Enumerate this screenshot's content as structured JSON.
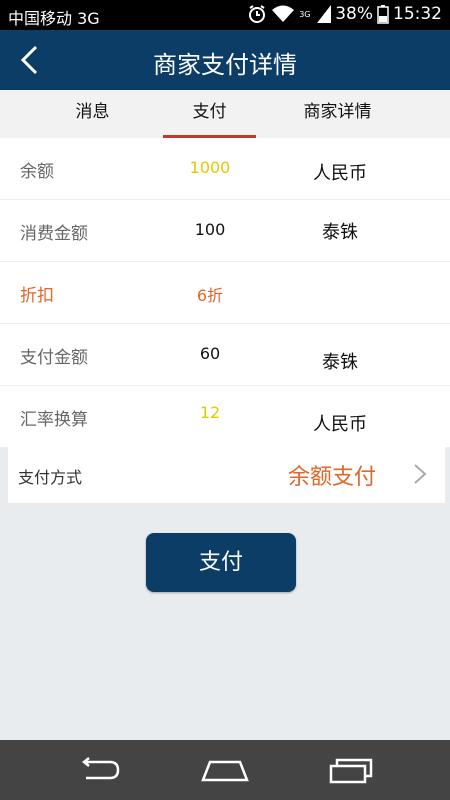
{
  "status_bar": {
    "carrier": "中国移动 3G",
    "network": "3G",
    "battery": "38%",
    "time": "15:32"
  },
  "header": {
    "title": "商家支付详情",
    "back_icon": "back-arrow-icon"
  },
  "tabs": [
    {
      "label": "消息",
      "active": false
    },
    {
      "label": "支付",
      "active": true
    },
    {
      "label": "商家详情",
      "active": false
    }
  ],
  "rows": [
    {
      "label": "余额",
      "value": "1000",
      "unit": "人民币"
    },
    {
      "label": "消费金额",
      "value": "100",
      "unit": "泰铢"
    },
    {
      "label": "折扣",
      "value": "6折",
      "unit": ""
    },
    {
      "label": "支付金额",
      "value": "60",
      "unit": "泰铢"
    },
    {
      "label": "汇率换算",
      "value": "12",
      "unit": "人民币"
    }
  ],
  "payment_method": {
    "label": "支付方式",
    "value": "余额支付"
  },
  "pay_button": {
    "label": "支付"
  },
  "colors": {
    "header": "#0c3d66",
    "accent_orange": "#e0662a",
    "accent_yellow": "#e6c800",
    "tab_indicator": "#c0392b"
  }
}
